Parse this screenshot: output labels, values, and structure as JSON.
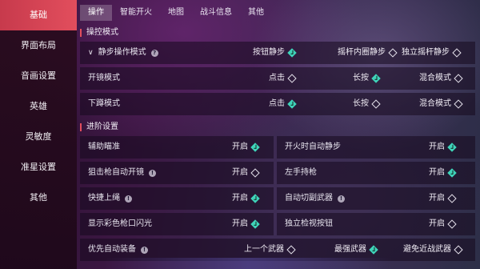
{
  "sidebar": {
    "items": [
      {
        "label": "基础"
      },
      {
        "label": "界面布局"
      },
      {
        "label": "音画设置"
      },
      {
        "label": "英雄"
      },
      {
        "label": "灵敏度"
      },
      {
        "label": "准星设置"
      },
      {
        "label": "其他"
      }
    ]
  },
  "tabs": [
    {
      "label": "操作"
    },
    {
      "label": "智能开火"
    },
    {
      "label": "地图"
    },
    {
      "label": "战斗信息"
    },
    {
      "label": "其他"
    }
  ],
  "control": {
    "header": "操控模式",
    "rows": [
      {
        "label": "静步操作模式",
        "info": "?",
        "options": [
          {
            "label": "按钮静步",
            "selected": true
          },
          {
            "label": "摇杆内圈静步",
            "selected": false
          },
          {
            "label": "独立摇杆静步",
            "selected": false
          }
        ]
      },
      {
        "label": "开镜模式",
        "options": [
          {
            "label": "点击",
            "selected": false
          },
          {
            "label": "长按",
            "selected": true
          },
          {
            "label": "混合模式",
            "selected": false
          }
        ]
      },
      {
        "label": "下蹲模式",
        "options": [
          {
            "label": "点击",
            "selected": true
          },
          {
            "label": "长按",
            "selected": false
          },
          {
            "label": "混合模式",
            "selected": false
          }
        ]
      }
    ]
  },
  "advanced": {
    "header": "进阶设置",
    "left": [
      {
        "label": "辅助瞄准",
        "info": "",
        "toggle": "开启",
        "on": true
      },
      {
        "label": "狙击枪自动开镜",
        "info": "!",
        "toggle": "开启",
        "on": false
      },
      {
        "label": "快捷上绳",
        "info": "!",
        "toggle": "开启",
        "on": true
      },
      {
        "label": "显示彩色枪口闪光",
        "info": "",
        "toggle": "开启",
        "on": true
      }
    ],
    "right": [
      {
        "label": "开火时自动静步",
        "info": "",
        "toggle": "开启",
        "on": true
      },
      {
        "label": "左手持枪",
        "info": "",
        "toggle": "开启",
        "on": true
      },
      {
        "label": "自动切副武器",
        "info": "!",
        "toggle": "开启",
        "on": false
      },
      {
        "label": "独立检视按钮",
        "info": "",
        "toggle": "开启",
        "on": false
      }
    ],
    "priority": {
      "label": "优先自动装备",
      "info": "!",
      "options": [
        {
          "label": "上一个武器",
          "selected": false
        },
        {
          "label": "最强武器",
          "selected": true
        },
        {
          "label": "避免近战武器",
          "selected": false
        }
      ]
    }
  },
  "colors": {
    "accent": "#e24e5d",
    "check": "#3fd3b9"
  }
}
